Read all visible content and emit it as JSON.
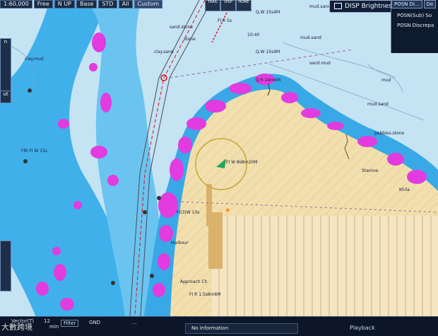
{
  "toolbar": {
    "scale": "1:60,000",
    "mode": "Free",
    "orientation": "N UP",
    "display_base": "Base",
    "display_std": "STD",
    "display_all": "All",
    "custom": "Custom",
    "icon_label_1": "TRAIL",
    "icon_label_2": "DISP",
    "icon_label_3": "HOME"
  },
  "disp_brightness": "DISP Brightness",
  "posn_panel": {
    "tab_label": "POSN Di...",
    "tab_2": "De",
    "row_1": "POSN(Sub) So",
    "row_2": "POSN Discrepa"
  },
  "left_tools": {
    "top": "n",
    "mid": "ut"
  },
  "status_bar": {
    "vector_label": "Vector(T)",
    "vector_value": "12",
    "vector_unit": "min",
    "filter": "Filter",
    "gnd": "GND",
    "dots": "...",
    "info": "No Information",
    "playback": "Playback",
    "watermark": "大數跨境"
  },
  "chart_labels": {
    "l1": "mud.sand",
    "l2": "Q.W 15s4M",
    "l3": "Fl R 5s",
    "l4": "mud.sand",
    "l5": "clay.mud",
    "l6": "sand.stone",
    "l7": "clay.sand",
    "l8": "mud",
    "l9": "Q.W 15s4M",
    "l10": "FlR FI W 15s",
    "l11": "Starove",
    "l12": "Khila",
    "l13": "FI R 1.5s8m8M",
    "l14": "FI W 8s8m20M",
    "l15": "Harbour",
    "l16": "pebbles.stone",
    "l17": "Approach Ch",
    "l18": "Q R 24m6M",
    "l19": "FI(3)W 10s",
    "l20": "mud.sand",
    "l21": "stone",
    "l22": "sand.mud",
    "l23": "10:40"
  },
  "colors": {
    "land": "#f2dfae",
    "shallow": "#3eb0ea",
    "deep": "#c3e3f3",
    "contour_magenta": "#e23be0",
    "route": "#d8141c"
  }
}
